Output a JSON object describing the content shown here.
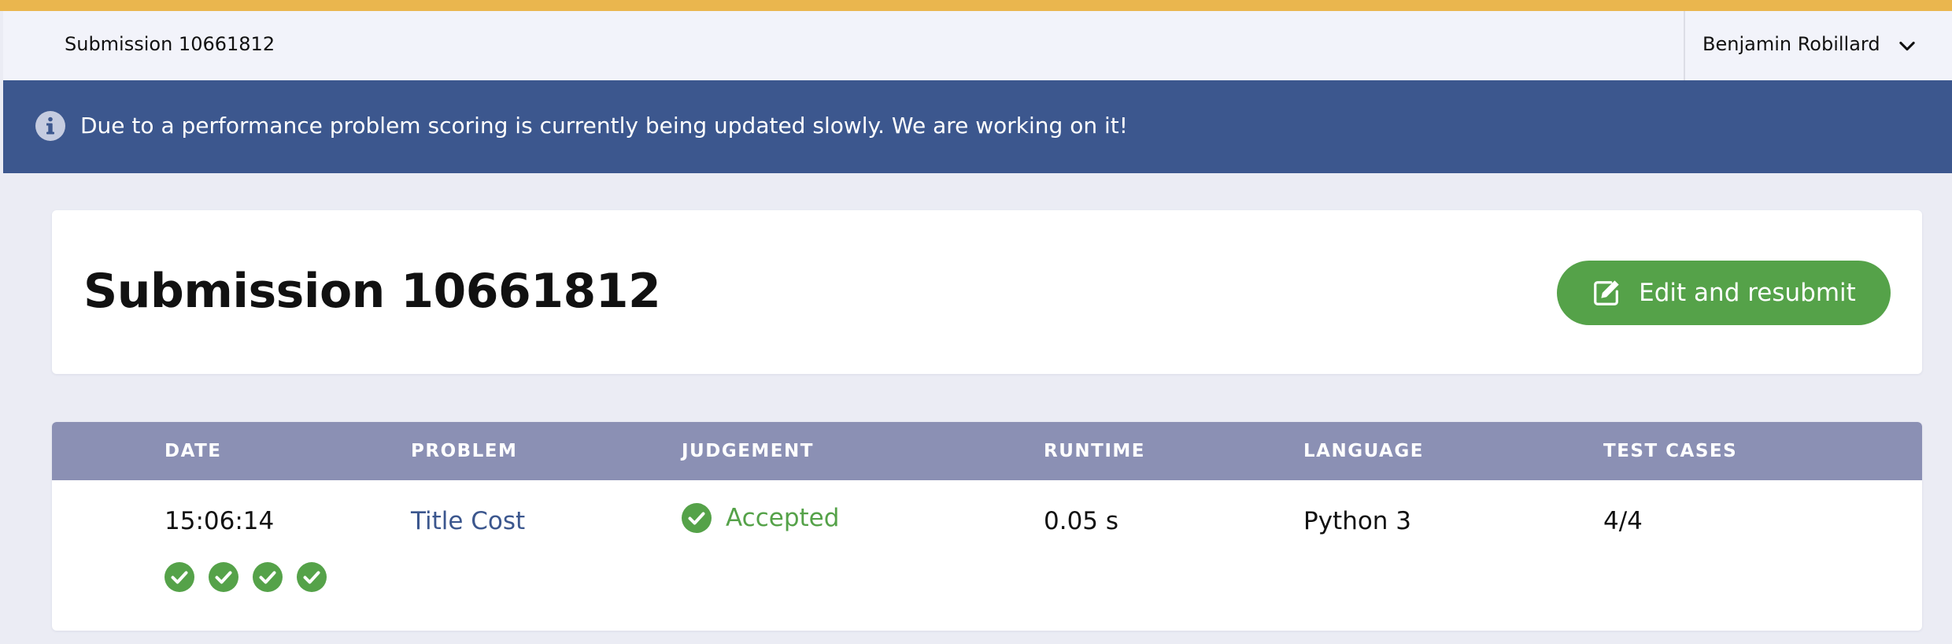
{
  "header": {
    "breadcrumb": "Submission 10661812",
    "user_name": "Benjamin Robillard",
    "user_menu_icon": "chevron-down-icon"
  },
  "banner": {
    "icon": "info-icon",
    "message": "Due to a performance problem scoring is currently being updated slowly. We are working on it!"
  },
  "page": {
    "title": "Submission 10661812",
    "edit_button_label": "Edit and resubmit",
    "edit_button_icon": "edit-icon"
  },
  "table": {
    "headers": {
      "date": "DATE",
      "problem": "PROBLEM",
      "judgement": "JUDGEMENT",
      "runtime": "RUNTIME",
      "language": "LANGUAGE",
      "test_cases": "TEST CASES"
    },
    "row": {
      "date": "15:06:14",
      "problem": "Title Cost",
      "judgement": "Accepted",
      "runtime": "0.05 s",
      "language": "Python 3",
      "test_cases": "4/4"
    },
    "test_case_results": [
      "passed",
      "passed",
      "passed",
      "passed"
    ]
  },
  "colors": {
    "top_stripe": "#eab64e",
    "banner": "#3c578e",
    "accent_green": "#55a249",
    "table_header": "#8b90b4",
    "link": "#3c578e"
  }
}
